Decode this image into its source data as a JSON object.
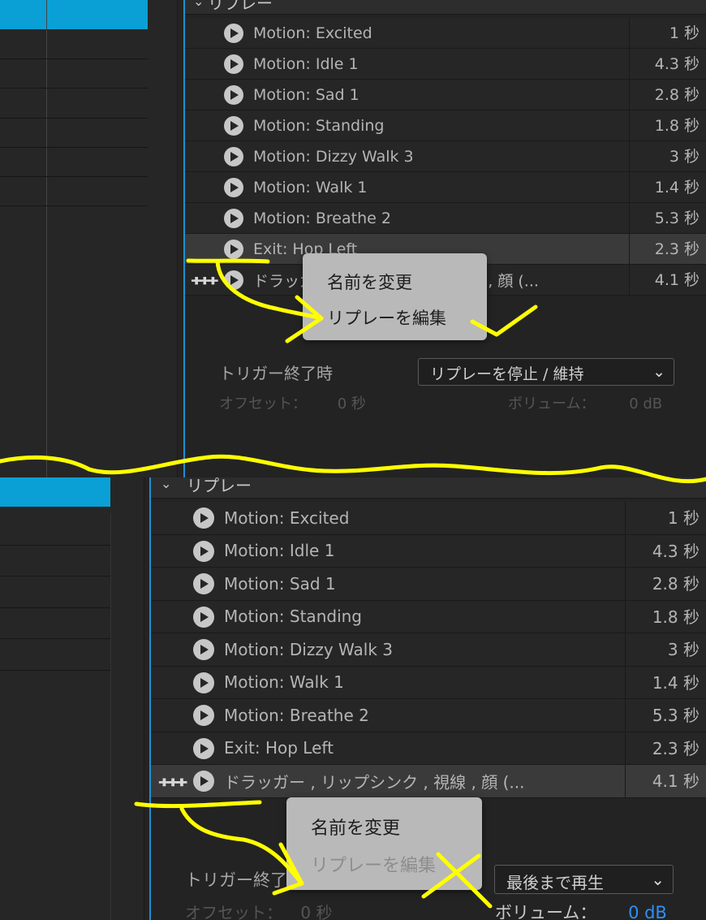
{
  "top": {
    "section_title": "リプレー",
    "rows": [
      {
        "name": "Motion: Excited",
        "duration": "1 秒"
      },
      {
        "name": "Motion: Idle 1",
        "duration": "4.3 秒"
      },
      {
        "name": "Motion: Sad 1",
        "duration": "2.8 秒"
      },
      {
        "name": "Motion: Standing",
        "duration": "1.8 秒"
      },
      {
        "name": "Motion: Dizzy Walk 3",
        "duration": "3 秒"
      },
      {
        "name": "Motion: Walk 1",
        "duration": "1.4 秒"
      },
      {
        "name": "Motion: Breathe 2",
        "duration": "5.3 秒"
      },
      {
        "name": "Exit: Hop Left",
        "duration": "2.3 秒",
        "highlighted": true
      },
      {
        "name": "ドラッガー , リップシンク , 視線 , 顔 (...",
        "duration": "4.1 秒",
        "audio": true
      }
    ],
    "context_menu": {
      "rename": "名前を変更",
      "edit_replay": "リプレーを編集"
    },
    "trigger_end_label": "トリガー終了時",
    "trigger_end_value": "リプレーを停止 / 維持",
    "offset_label": "オフセット：",
    "offset_value": "0 秒",
    "volume_label": "ボリューム：",
    "volume_value": "0 dB"
  },
  "bottom": {
    "section_title": "リプレー",
    "rows": [
      {
        "name": "Motion: Excited",
        "duration": "1 秒"
      },
      {
        "name": "Motion: Idle 1",
        "duration": "4.3 秒"
      },
      {
        "name": "Motion: Sad 1",
        "duration": "2.8 秒"
      },
      {
        "name": "Motion: Standing",
        "duration": "1.8 秒"
      },
      {
        "name": "Motion: Dizzy Walk 3",
        "duration": "3 秒"
      },
      {
        "name": "Motion: Walk 1",
        "duration": "1.4 秒"
      },
      {
        "name": "Motion: Breathe 2",
        "duration": "5.3 秒"
      },
      {
        "name": "Exit: Hop Left",
        "duration": "2.3 秒"
      },
      {
        "name": "ドラッガー , リップシンク , 視線 , 顔 (...",
        "duration": "4.1 秒",
        "audio": true,
        "highlighted": true
      }
    ],
    "context_menu": {
      "rename": "名前を変更",
      "edit_replay": "リプレーを編集"
    },
    "trigger_end_label": "トリガー終了時",
    "trigger_end_value": "最後まで再生",
    "offset_label": "オフセット：",
    "offset_value": "0 秒",
    "volume_label": "ボリューム：",
    "volume_value": "0 dB"
  },
  "icons": {
    "play": "play-icon",
    "audio": "waveform-icon",
    "chevron": "chevron-down-icon"
  },
  "colors": {
    "accent_blue": "#1f8fd0",
    "timeline_blue": "#0aa0d6",
    "annotation": "#ffff00",
    "volume_value_active": "#2f8fff"
  }
}
